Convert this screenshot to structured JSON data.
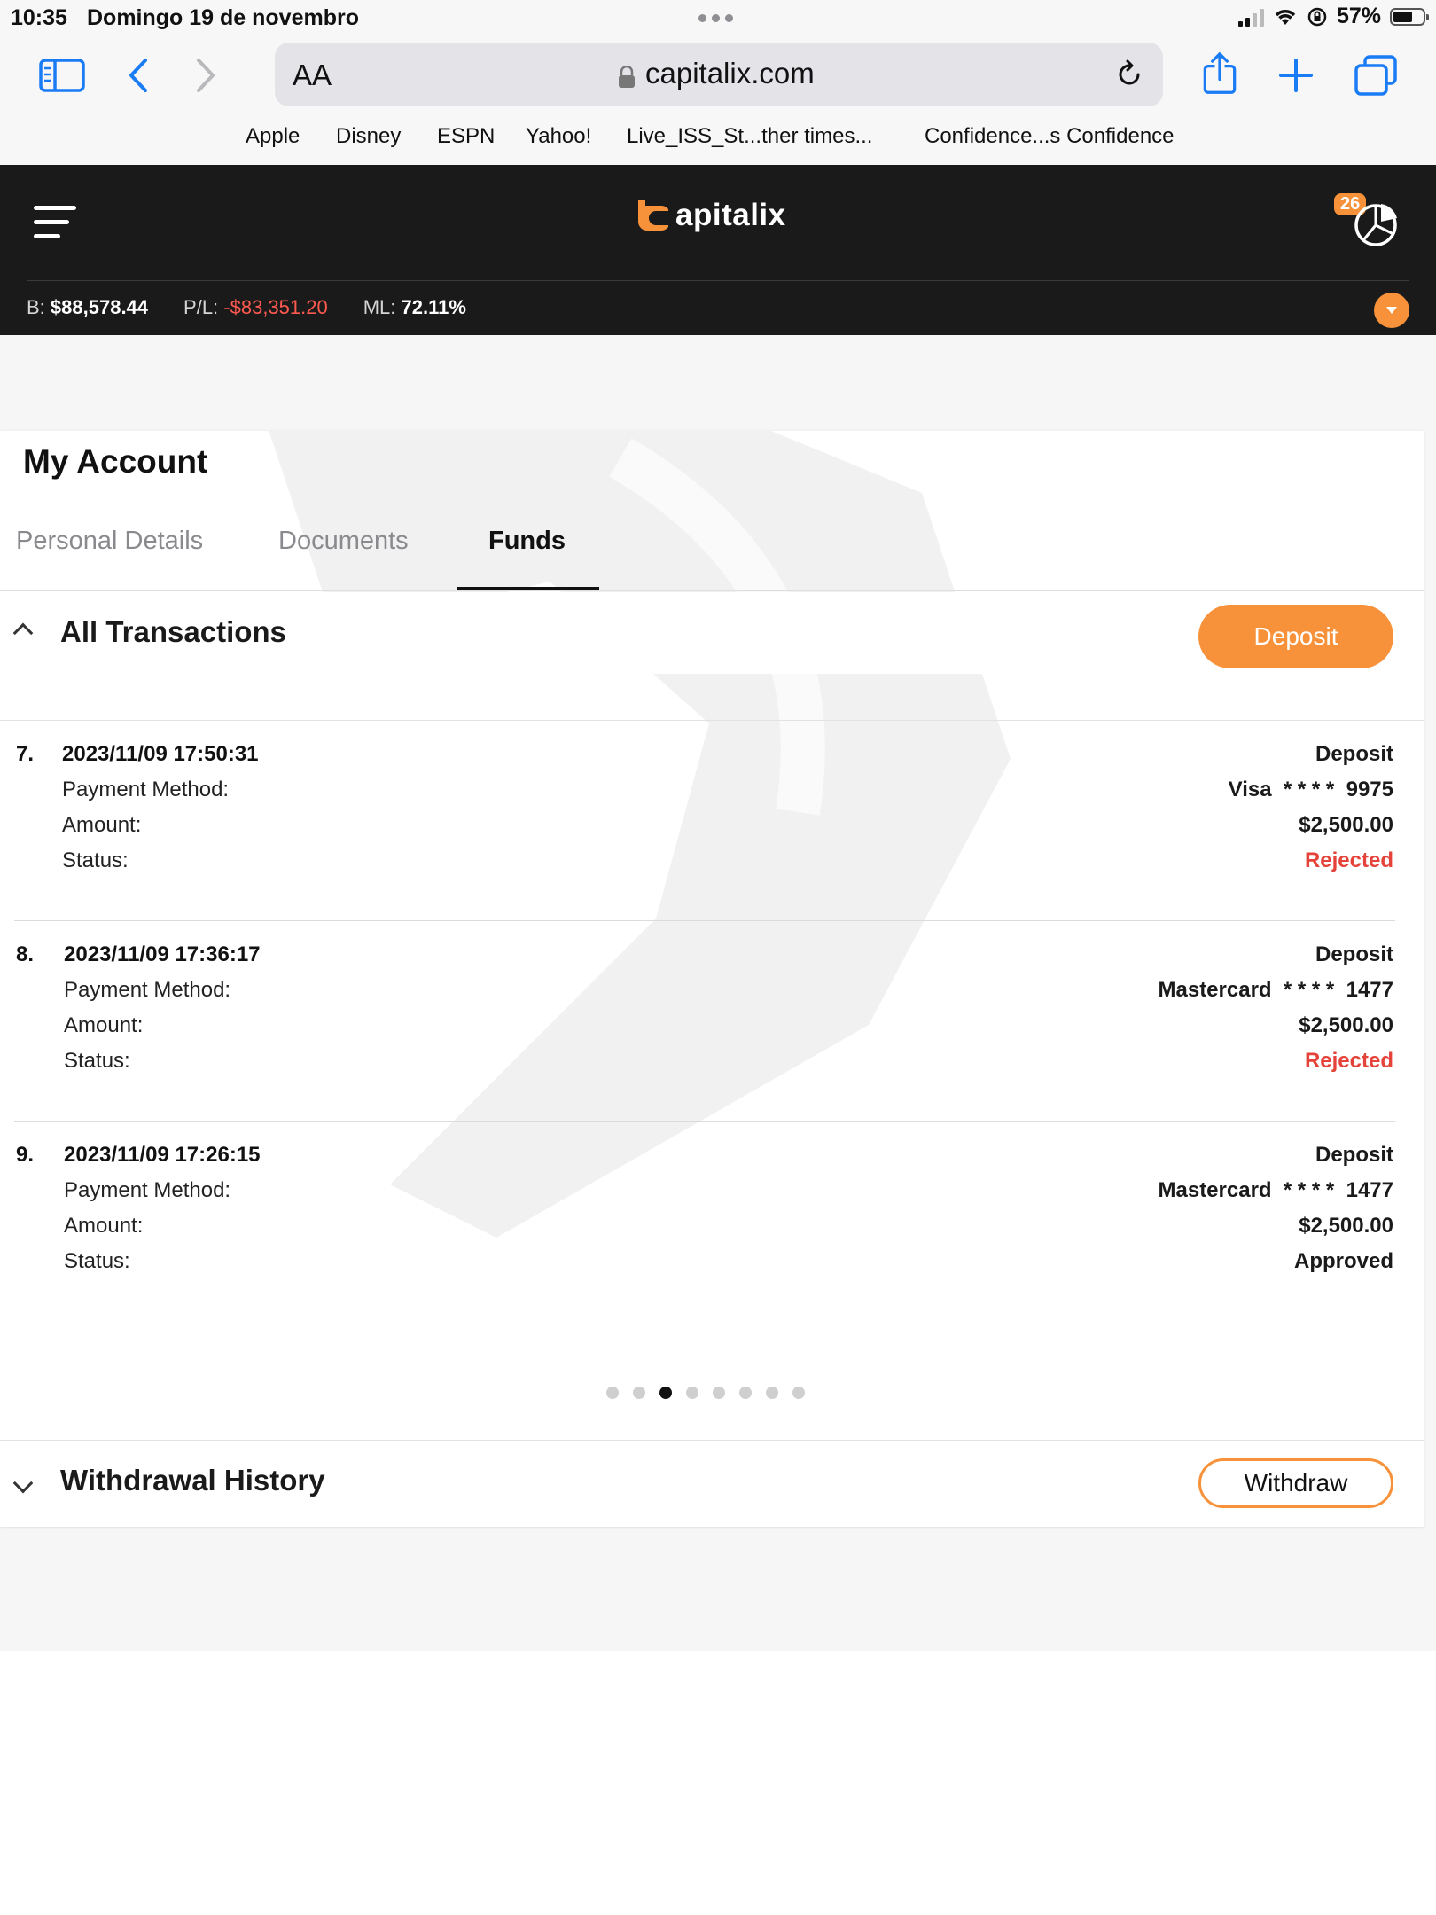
{
  "status_bar": {
    "time": "10:35",
    "date": "Domingo 19 de novembro",
    "battery": "57%"
  },
  "browser": {
    "text_size_label": "AA",
    "url": "capitalix.com",
    "favorites": [
      "Apple",
      "Disney",
      "ESPN",
      "Yahoo!",
      "Live_ISS_St...ther times...",
      "Confidence...s Confidence"
    ]
  },
  "app_header": {
    "logo_text": "apitalix",
    "notification_count": "26",
    "stats": {
      "balance_label": "B:",
      "balance_value": "$88,578.44",
      "pl_label": "P/L:",
      "pl_value": "-$83,351.20",
      "ml_label": "ML:",
      "ml_value": "72.11%"
    },
    "colors": {
      "accent": "#f7923a",
      "negative": "#ff5a4f",
      "background": "#1a1a1a"
    }
  },
  "account": {
    "title": "My Account",
    "tabs": [
      {
        "label": "Personal Details",
        "active": false
      },
      {
        "label": "Documents",
        "active": false
      },
      {
        "label": "Funds",
        "active": true
      }
    ]
  },
  "transactions_section": {
    "title": "All Transactions",
    "deposit_button": "Deposit",
    "field_labels": {
      "payment_method": "Payment Method:",
      "amount": "Amount:",
      "status": "Status:"
    },
    "items": [
      {
        "number": "7.",
        "datetime": "2023/11/09 17:50:31",
        "type": "Deposit",
        "payment_method": "Visa  * * * *  9975",
        "amount": "$2,500.00",
        "status": "Rejected"
      },
      {
        "number": "8.",
        "datetime": "2023/11/09 17:36:17",
        "type": "Deposit",
        "payment_method": "Mastercard  * * * *  1477",
        "amount": "$2,500.00",
        "status": "Rejected"
      },
      {
        "number": "9.",
        "datetime": "2023/11/09 17:26:15",
        "type": "Deposit",
        "payment_method": "Mastercard  * * * *  1477",
        "amount": "$2,500.00",
        "status": "Approved"
      }
    ],
    "pagination": {
      "total_pages": 8,
      "current_page": 3
    }
  },
  "withdrawal_section": {
    "title": "Withdrawal History",
    "withdraw_button": "Withdraw"
  }
}
